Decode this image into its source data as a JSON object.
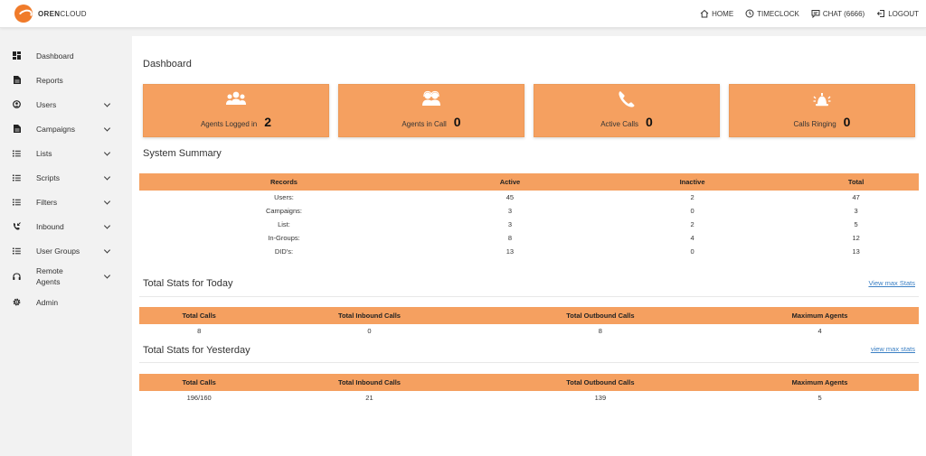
{
  "brand": {
    "logo_bold": "OREN",
    "logo_light": "CLOUD"
  },
  "topnav": [
    {
      "label": "HOME",
      "icon": "home-icon"
    },
    {
      "label": "TIMECLOCK",
      "icon": "clock-icon"
    },
    {
      "label": "CHAT (6666)",
      "icon": "chat-icon"
    },
    {
      "label": "LOGOUT",
      "icon": "logout-icon"
    }
  ],
  "sidebar": {
    "items": [
      {
        "label": "Dashboard",
        "icon": "dashboard-icon"
      },
      {
        "label": "Reports",
        "icon": "document-icon"
      },
      {
        "label": "Users",
        "icon": "user-circle-icon"
      },
      {
        "label": "Campaigns",
        "icon": "document-icon"
      },
      {
        "label": "Lists",
        "icon": "list-icon"
      },
      {
        "label": "Scripts",
        "icon": "list-icon"
      },
      {
        "label": "Filters",
        "icon": "list-icon"
      },
      {
        "label": "Inbound",
        "icon": "phone-incoming-icon"
      },
      {
        "label": "User Groups",
        "icon": "list-icon"
      },
      {
        "label": "Remote Agents",
        "icon": "headset-icon"
      },
      {
        "label": "Admin",
        "icon": "gear-icon"
      }
    ]
  },
  "main": {
    "title": "Dashboard",
    "cards": [
      {
        "label": "Agents Logged in",
        "value": "2",
        "icon": "users-group-icon"
      },
      {
        "label": "Agents in Call",
        "value": "0",
        "icon": "agents-headset-icon"
      },
      {
        "label": "Active Calls",
        "value": "0",
        "icon": "phone-icon"
      },
      {
        "label": "Calls Ringing",
        "value": "0",
        "icon": "bell-ringing-icon"
      }
    ],
    "system_summary": {
      "title": "System Summary",
      "headers": [
        "Records",
        "Active",
        "Inactive",
        "Total"
      ],
      "rows": [
        [
          "Users:",
          "45",
          "2",
          "47"
        ],
        [
          "Campaigns:",
          "3",
          "0",
          "3"
        ],
        [
          "List:",
          "3",
          "2",
          "5"
        ],
        [
          "In-Groups:",
          "8",
          "4",
          "12"
        ],
        [
          "DID's:",
          "13",
          "0",
          "13"
        ]
      ]
    },
    "today": {
      "title": "Total Stats for Today",
      "link": "View max Stats",
      "headers": [
        "Total Calls",
        "Total Inbound Calls",
        "Total Outbound Calls",
        "Maximum Agents"
      ],
      "rows": [
        [
          "8",
          "0",
          "8",
          "4"
        ]
      ]
    },
    "yesterday": {
      "title": "Total Stats for Yesterday",
      "link": "view max stats",
      "headers": [
        "Total Calls",
        "Total Inbound Calls",
        "Total Outbound Calls",
        "Maximum Agents"
      ],
      "rows": [
        [
          "196/160",
          "21",
          "139",
          "5"
        ]
      ]
    }
  },
  "colors": {
    "accent": "#f5a060",
    "brand": "#f07b2a",
    "link": "#3a7fc4"
  }
}
